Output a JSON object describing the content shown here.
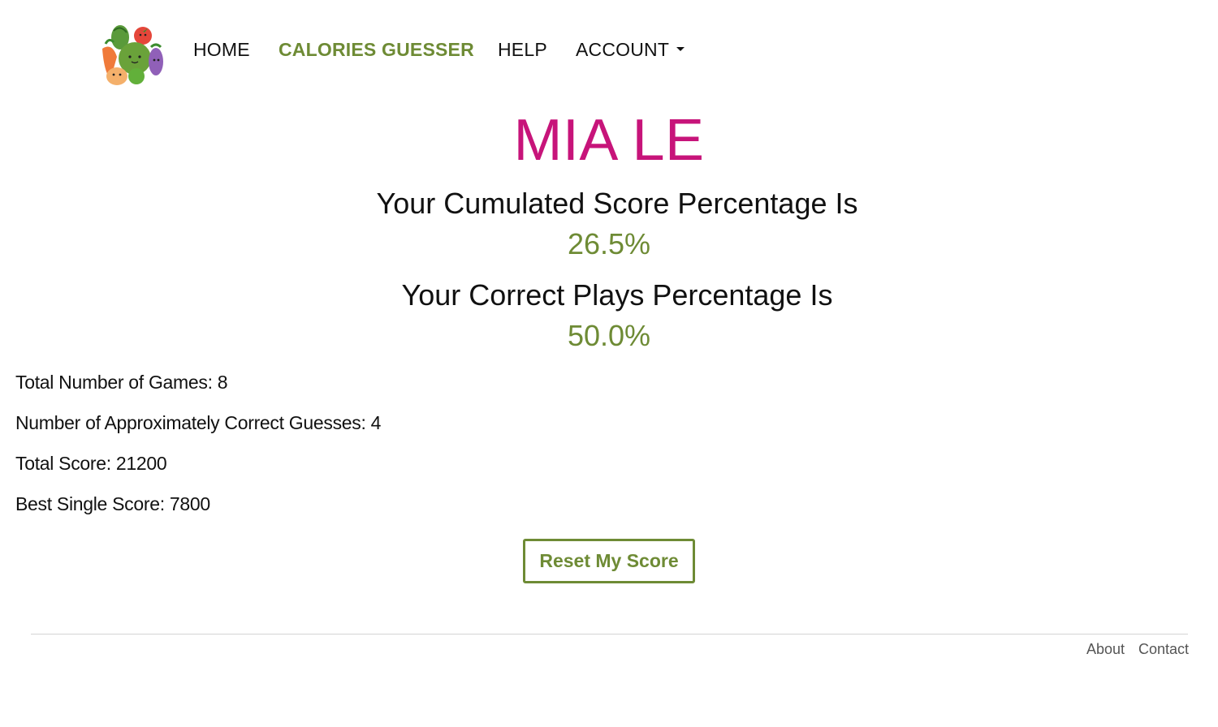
{
  "nav": {
    "logo_icon": "vegetables-logo-icon",
    "items": [
      {
        "label": "HOME",
        "active": false
      },
      {
        "label": "CALORIES GUESSER",
        "active": true
      },
      {
        "label": "HELP",
        "active": false
      },
      {
        "label": "ACCOUNT",
        "active": false,
        "has_dropdown": true
      }
    ]
  },
  "profile": {
    "name": "MIA LE",
    "cumulated_heading": "Your Cumulated Score Percentage Is",
    "cumulated_value": "26.5%",
    "correct_heading": "Your Correct Plays Percentage Is",
    "correct_value": "50.0%"
  },
  "details": {
    "total_games": "Total Number of Games: 8",
    "approx_correct": "Number of Approximately Correct Guesses: 4",
    "total_score": "Total Score: 21200",
    "best_score": "Best Single Score: 7800"
  },
  "actions": {
    "reset_label": "Reset My Score"
  },
  "footer": {
    "about": "About",
    "contact": "Contact"
  },
  "colors": {
    "accent_green": "#6e8b35",
    "name_magenta": "#c7147a"
  }
}
